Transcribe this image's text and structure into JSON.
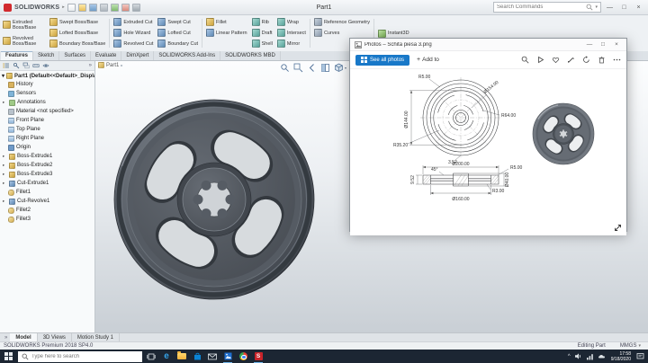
{
  "titlebar": {
    "app_name": "SOLIDWORKS",
    "doc_title": "Part1",
    "search_placeholder": "Search Commands"
  },
  "ribbon_tabs": [
    "Features",
    "Sketch",
    "Surfaces",
    "Evaluate",
    "DimXpert",
    "SOLIDWORKS Add-Ins",
    "SOLIDWORKS MBD"
  ],
  "ribbon": {
    "buttons": [
      "Extruded Boss/Base",
      "Revolved Boss/Base",
      "Swept Boss/Base",
      "Lofted Boss/Base",
      "Boundary Boss/Base",
      "Extruded Cut",
      "Hole Wizard",
      "Revolved Cut",
      "Swept Cut",
      "Lofted Cut",
      "Boundary Cut",
      "Fillet",
      "Linear Pattern",
      "Rib",
      "Draft",
      "Shell",
      "Wrap",
      "Intersect",
      "Mirror",
      "Reference Geometry",
      "Curves",
      "Instant3D"
    ]
  },
  "feature_tree": {
    "root": "Part1 (Default<<Default>_Display Sta",
    "items": [
      "History",
      "Sensors",
      "Annotations",
      "Material <not specified>",
      "Front Plane",
      "Top Plane",
      "Right Plane",
      "Origin",
      "Boss-Extrude1",
      "Boss-Extrude2",
      "Boss-Extrude3",
      "Cut-Extrude1",
      "Fillet1",
      "Cut-Revolve1",
      "Fillet2",
      "Fillet3"
    ]
  },
  "viewport": {
    "flyout_doc": "Part1"
  },
  "photos_window": {
    "title": "Photos – Schita piesa 3.png",
    "see_all_label": "See all photos",
    "add_to_label": "Add to",
    "drawing": {
      "dims": [
        "R5.00",
        "Ø154.00",
        "R64.00",
        "R35.20",
        "Ø144.00",
        "3.52",
        "Ø200.00",
        "9.52",
        "45°",
        "R5.00",
        "R3.00",
        "Ø160.00",
        "Ø40.00"
      ]
    }
  },
  "bottom_tabs": [
    "Model",
    "3D Views",
    "Motion Study 1"
  ],
  "statusbar": {
    "left_text": "SOLIDWORKS Premium 2018 SP4.0",
    "editing": "Editing Part",
    "units": "MMGS"
  },
  "taskbar": {
    "search_placeholder": "Type here to search",
    "time": "17:58",
    "date": "9/18/2020"
  }
}
